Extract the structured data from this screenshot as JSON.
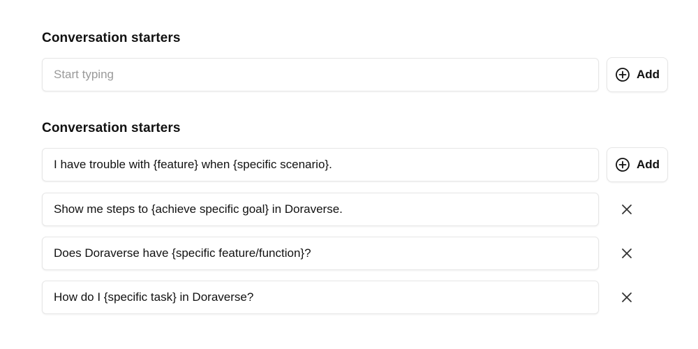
{
  "section1": {
    "title": "Conversation starters",
    "input_placeholder": "Start typing",
    "input_value": "",
    "add_label": "Add",
    "add_icon": "plus-circle-icon"
  },
  "section2": {
    "title": "Conversation starters",
    "add_label": "Add",
    "add_icon": "plus-circle-icon",
    "remove_icon": "close-icon",
    "starters": [
      "I have trouble with {feature} when {specific scenario}.",
      "Show me steps to {achieve specific goal} in Doraverse.",
      "Does Doraverse have {specific feature/function}?",
      "How do I {specific task} in Doraverse?"
    ]
  }
}
